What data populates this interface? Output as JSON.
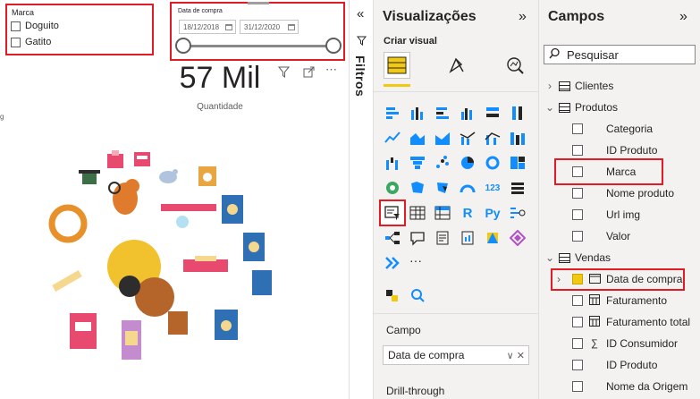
{
  "canvas": {
    "slicer_marca": {
      "title": "Marca",
      "options": [
        "Doguito",
        "Gatito"
      ]
    },
    "slicer_date": {
      "title": "Data de compra",
      "start": "18/12/2018",
      "end": "31/12/2020"
    },
    "kpi": {
      "value": "57 Mil",
      "label": "Quantidade"
    },
    "visual_menu": "⋯",
    "stray_glyph": "g"
  },
  "filtros": {
    "label": "Filtros",
    "collapse": "«"
  },
  "visualizations": {
    "title": "Visualizações",
    "expand": "»",
    "subtitle": "Criar visual",
    "grid_text_cells": [
      "123",
      "R",
      "Py"
    ],
    "more": "···",
    "campo_label": "Campo",
    "campo_value": "Data de compra",
    "campo_actions": "∨ ✕",
    "drill_label": "Drill-through"
  },
  "fields": {
    "title": "Campos",
    "expand": "»",
    "search_placeholder": "Pesquisar",
    "tables": [
      {
        "name": "Clientes",
        "expanded": false
      },
      {
        "name": "Produtos",
        "expanded": true,
        "fields": [
          "Categoria",
          "ID Produto",
          "Marca",
          "Nome produto",
          "Url img",
          "Valor"
        ]
      },
      {
        "name": "Vendas",
        "expanded": true,
        "fields": [
          "Data de compra",
          "Faturamento",
          "Faturamento total",
          "ID Consumidor",
          "ID Produto",
          "Nome da Origem"
        ]
      }
    ],
    "sigma": "∑"
  },
  "colors": {
    "accent": "#f2c811",
    "highlight": "#e11c24",
    "viz_blue": "#118dff"
  }
}
